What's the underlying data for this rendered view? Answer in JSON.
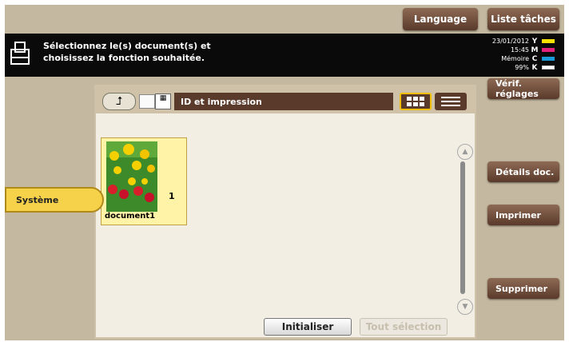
{
  "header": {
    "language_label": "Language",
    "tasks_label": "Liste tâches"
  },
  "message": {
    "line1": "Sélectionnez le(s) document(s) et",
    "line2": "choisissez la fonction souhaitée.",
    "icon": "printer-icon"
  },
  "status": {
    "date": "23/01/2012",
    "time": "15:45",
    "memory_label": "Mémoire",
    "memory_value": "99%",
    "toner": [
      {
        "letter": "Y",
        "color": "#f5e000"
      },
      {
        "letter": "M",
        "color": "#e0207a"
      },
      {
        "letter": "C",
        "color": "#1a9ad8"
      },
      {
        "letter": "K",
        "color": "#ffffff"
      }
    ]
  },
  "sidebar": {
    "active_tab": "Système"
  },
  "panel": {
    "path": "ID et impression",
    "up_icon": "up-arrow-icon",
    "thumbnail_view_icon": "grid-view-icon",
    "list_view_icon": "list-view-icon",
    "documents": [
      {
        "name": "document1",
        "count": "1"
      }
    ],
    "init_label": "Initialiser",
    "select_all_label": "Tout sélection"
  },
  "right": {
    "check_settings": "Vérif. réglages",
    "doc_details": "Détails doc.",
    "print": "Imprimer",
    "delete": "Supprimer"
  },
  "colors": {
    "brown_button": "#5a3a2b",
    "active_yellow": "#f6d24a",
    "background": "#c5b8a0"
  }
}
